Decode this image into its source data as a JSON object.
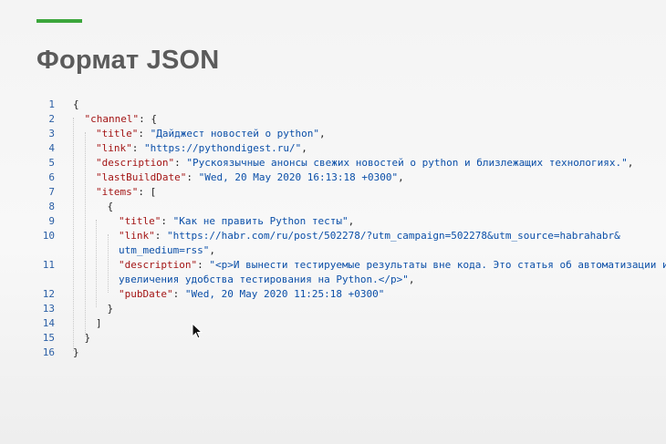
{
  "slide": {
    "title": "Формат JSON"
  },
  "code": {
    "lines": [
      {
        "n": "1",
        "parts": [
          [
            "punct",
            "{"
          ]
        ]
      },
      {
        "n": "2",
        "parts": [
          [
            "key",
            "\"channel\""
          ],
          [
            "punct",
            ": {"
          ]
        ]
      },
      {
        "n": "3",
        "parts": [
          [
            "key",
            "\"title\""
          ],
          [
            "punct",
            ": "
          ],
          [
            "str",
            "\"Дайджест новостей о python\""
          ],
          [
            "punct",
            ","
          ]
        ]
      },
      {
        "n": "4",
        "parts": [
          [
            "key",
            "\"link\""
          ],
          [
            "punct",
            ": "
          ],
          [
            "str",
            "\"https://pythondigest.ru/\""
          ],
          [
            "punct",
            ","
          ]
        ]
      },
      {
        "n": "5",
        "parts": [
          [
            "key",
            "\"description\""
          ],
          [
            "punct",
            ": "
          ],
          [
            "str",
            "\"Рускоязычные анонсы свежих новостей о python и близлежащих технологиях.\""
          ],
          [
            "punct",
            ","
          ]
        ]
      },
      {
        "n": "6",
        "parts": [
          [
            "key",
            "\"lastBuildDate\""
          ],
          [
            "punct",
            ": "
          ],
          [
            "str",
            "\"Wed, 20 May 2020 16:13:18 +0300\""
          ],
          [
            "punct",
            ","
          ]
        ]
      },
      {
        "n": "7",
        "parts": [
          [
            "key",
            "\"items\""
          ],
          [
            "punct",
            ": ["
          ]
        ]
      },
      {
        "n": "8",
        "parts": [
          [
            "punct",
            "{"
          ]
        ]
      },
      {
        "n": "9",
        "parts": [
          [
            "key",
            "\"title\""
          ],
          [
            "punct",
            ": "
          ],
          [
            "str",
            "\"Как не править Python тесты\""
          ],
          [
            "punct",
            ","
          ]
        ]
      },
      {
        "n": "10",
        "parts": [
          [
            "key",
            "\"link\""
          ],
          [
            "punct",
            ": "
          ],
          [
            "str",
            "\"https://habr.com/ru/post/502278/?utm_campaign=502278&utm_source=habrahabr&"
          ]
        ]
      },
      {
        "n": "",
        "parts": [
          [
            "str",
            "utm_medium=rss\""
          ],
          [
            "punct",
            ","
          ]
        ]
      },
      {
        "n": "11",
        "parts": [
          [
            "key",
            "\"description\""
          ],
          [
            "punct",
            ": "
          ],
          [
            "str",
            "\"<p>И вынести тестируемые результаты вне кода. Это статья об автоматизации и"
          ]
        ]
      },
      {
        "n": "",
        "parts": [
          [
            "str",
            "увеличения удобства тестирования на Python.</p>\""
          ],
          [
            "punct",
            ","
          ]
        ]
      },
      {
        "n": "12",
        "parts": [
          [
            "key",
            "\"pubDate\""
          ],
          [
            "punct",
            ": "
          ],
          [
            "str",
            "\"Wed, 20 May 2020 11:25:18 +0300\""
          ]
        ]
      },
      {
        "n": "13",
        "parts": [
          [
            "punct",
            "}"
          ]
        ]
      },
      {
        "n": "14",
        "parts": [
          [
            "punct",
            "]"
          ]
        ]
      },
      {
        "n": "15",
        "parts": [
          [
            "punct",
            "}"
          ]
        ]
      },
      {
        "n": "16",
        "parts": [
          [
            "punct",
            "}"
          ]
        ]
      }
    ]
  }
}
